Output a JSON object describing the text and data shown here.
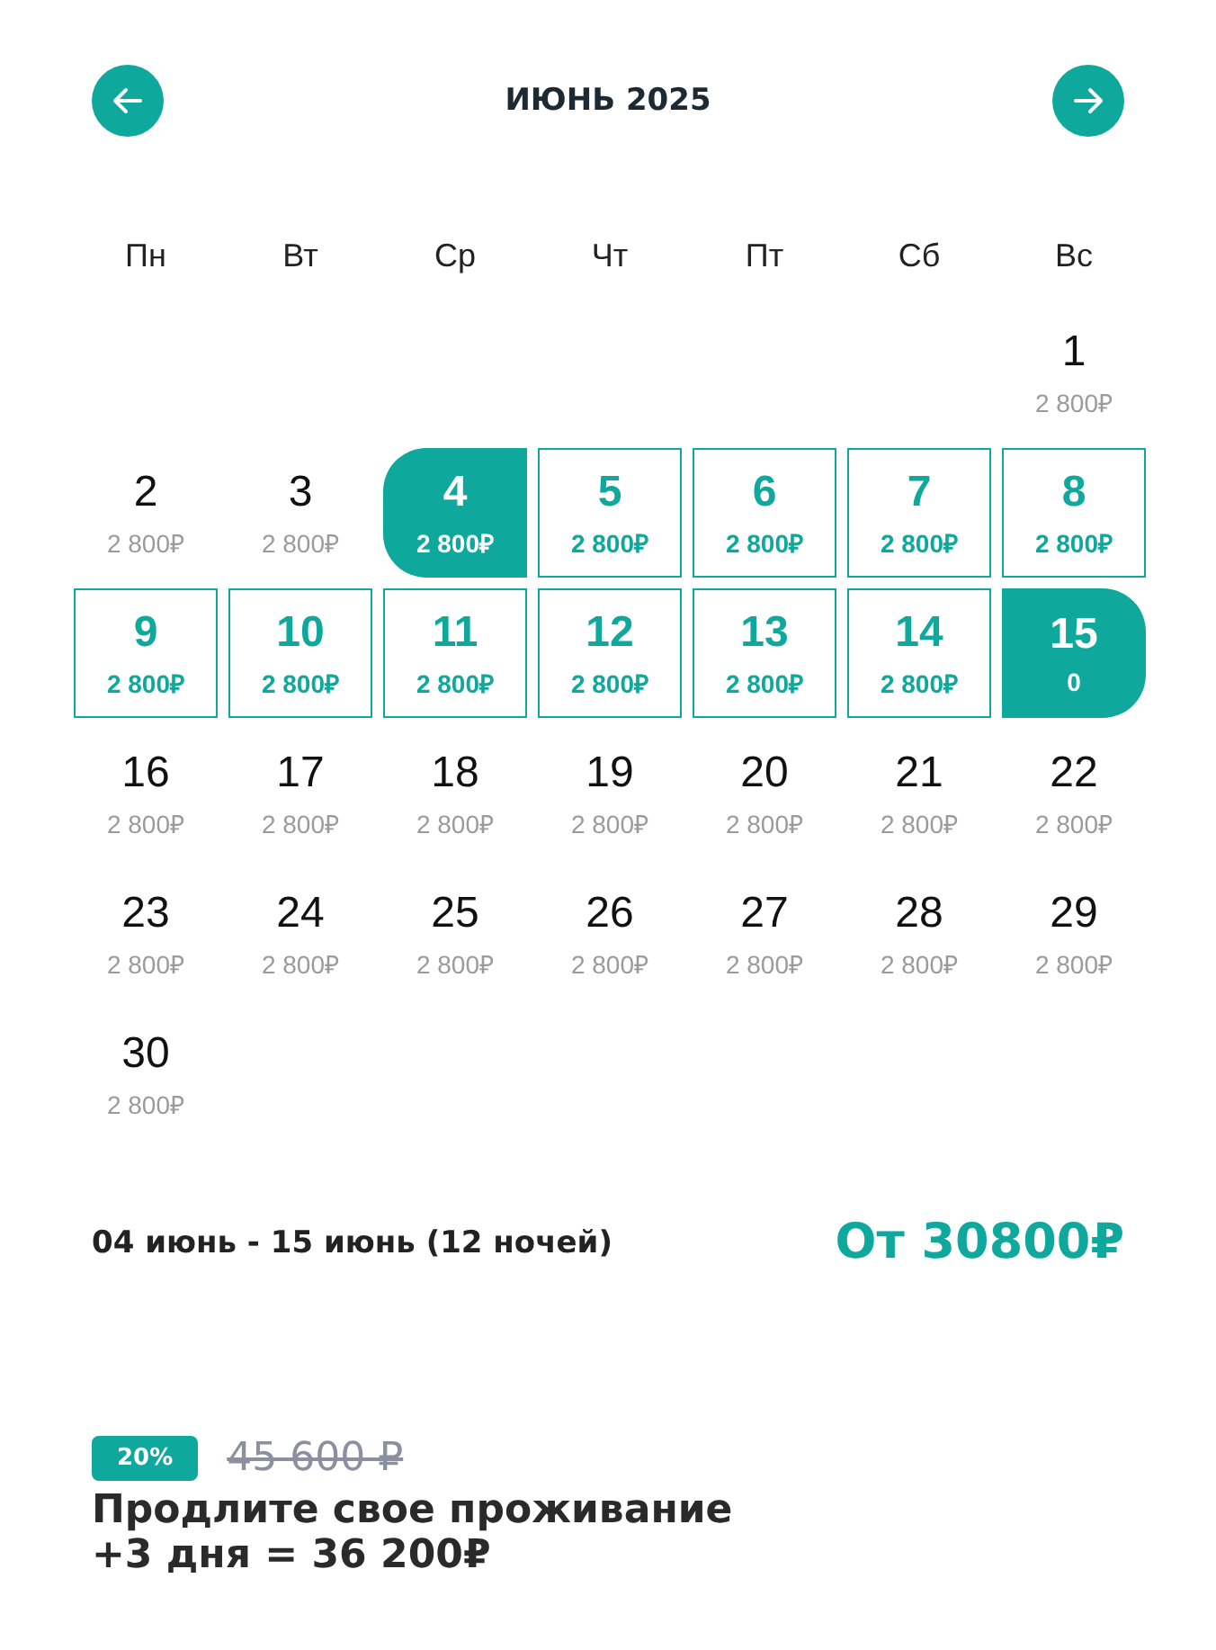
{
  "header": {
    "title": "ИЮНЬ 2025"
  },
  "weekdays": [
    "Пн",
    "Вт",
    "Ср",
    "Чт",
    "Пт",
    "Сб",
    "Вс"
  ],
  "weeks": [
    [
      {
        "day": "1",
        "price": "2 800₽",
        "kind": "plain"
      }
    ],
    [
      {
        "day": "2",
        "price": "2 800₽",
        "kind": "plain"
      },
      {
        "day": "3",
        "price": "2 800₽",
        "kind": "plain"
      },
      {
        "day": "4",
        "price": "2 800₽",
        "kind": "start"
      },
      {
        "day": "5",
        "price": "2 800₽",
        "kind": "range"
      },
      {
        "day": "6",
        "price": "2 800₽",
        "kind": "range"
      },
      {
        "day": "7",
        "price": "2 800₽",
        "kind": "range"
      },
      {
        "day": "8",
        "price": "2 800₽",
        "kind": "range"
      }
    ],
    [
      {
        "day": "9",
        "price": "2 800₽",
        "kind": "range"
      },
      {
        "day": "10",
        "price": "2 800₽",
        "kind": "range"
      },
      {
        "day": "11",
        "price": "2 800₽",
        "kind": "range"
      },
      {
        "day": "12",
        "price": "2 800₽",
        "kind": "range"
      },
      {
        "day": "13",
        "price": "2 800₽",
        "kind": "range"
      },
      {
        "day": "14",
        "price": "2 800₽",
        "kind": "range"
      },
      {
        "day": "15",
        "price": "0",
        "kind": "end"
      }
    ],
    [
      {
        "day": "16",
        "price": "2 800₽",
        "kind": "plain"
      },
      {
        "day": "17",
        "price": "2 800₽",
        "kind": "plain"
      },
      {
        "day": "18",
        "price": "2 800₽",
        "kind": "plain"
      },
      {
        "day": "19",
        "price": "2 800₽",
        "kind": "plain"
      },
      {
        "day": "20",
        "price": "2 800₽",
        "kind": "plain"
      },
      {
        "day": "21",
        "price": "2 800₽",
        "kind": "plain"
      },
      {
        "day": "22",
        "price": "2 800₽",
        "kind": "plain"
      }
    ],
    [
      {
        "day": "23",
        "price": "2 800₽",
        "kind": "plain"
      },
      {
        "day": "24",
        "price": "2 800₽",
        "kind": "plain"
      },
      {
        "day": "25",
        "price": "2 800₽",
        "kind": "plain"
      },
      {
        "day": "26",
        "price": "2 800₽",
        "kind": "plain"
      },
      {
        "day": "27",
        "price": "2 800₽",
        "kind": "plain"
      },
      {
        "day": "28",
        "price": "2 800₽",
        "kind": "plain"
      },
      {
        "day": "29",
        "price": "2 800₽",
        "kind": "plain"
      }
    ],
    [
      {
        "day": "30",
        "price": "2 800₽",
        "kind": "plain"
      }
    ]
  ],
  "summary": {
    "dates": "04 июнь - 15 июнь (12 ночей)",
    "total": "От 30800₽"
  },
  "offer": {
    "discount": "20%",
    "old_price": "45 600 ₽",
    "text": "Продлите свое проживание +3 дня = 36 200₽"
  }
}
